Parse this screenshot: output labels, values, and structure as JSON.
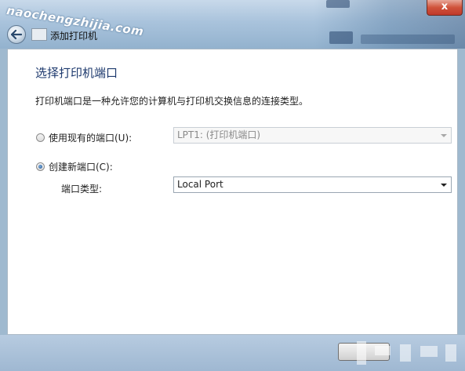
{
  "window": {
    "title": "添加打印机",
    "close_label": "x",
    "watermark": "naochengzhijia.com"
  },
  "content": {
    "heading": "选择打印机端口",
    "description": "打印机端口是一种允许您的计算机与打印机交换信息的连接类型。",
    "use_existing": {
      "label": "使用现有的端口(U):",
      "selected": false,
      "value": "LPT1: (打印机端口)"
    },
    "create_new": {
      "label": "创建新端口(C):",
      "selected": true,
      "port_type_label": "端口类型:",
      "value": "Local Port"
    }
  },
  "icons": {
    "back": "back-arrow-icon",
    "app": "printer-icon",
    "dropdown": "chevron-down-icon"
  },
  "colors": {
    "heading": "#1e3a6e",
    "titlebar": "#a9c3dc",
    "close": "#c0392b"
  }
}
